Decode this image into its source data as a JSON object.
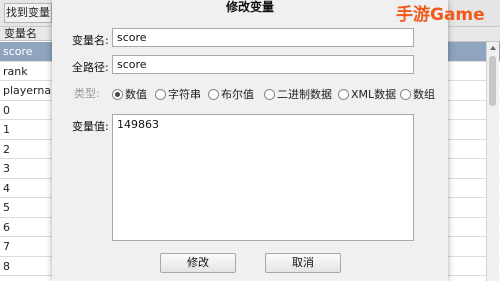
{
  "background": {
    "find_button_label": "找到变量",
    "column_header": "变量名",
    "rows": [
      {
        "name": "score",
        "selected": true
      },
      {
        "name": "rank",
        "selected": false
      },
      {
        "name": "playername",
        "selected": false
      },
      {
        "name": "0",
        "selected": false
      },
      {
        "name": "1",
        "selected": false
      },
      {
        "name": "2",
        "selected": false
      },
      {
        "name": "3",
        "selected": false
      },
      {
        "name": "4",
        "selected": false
      },
      {
        "name": "5",
        "selected": false
      },
      {
        "name": "6",
        "selected": false
      },
      {
        "name": "7",
        "selected": false
      },
      {
        "name": "8",
        "selected": false
      }
    ],
    "selection_color": "#8ea4bf"
  },
  "dialog": {
    "title": "修改变量",
    "var_name_label": "变量名:",
    "var_name_value": "score",
    "full_path_label": "全路径:",
    "full_path_value": "score",
    "type_label": "类型:",
    "types": [
      {
        "label": "数值",
        "checked": true
      },
      {
        "label": "字符串",
        "checked": false
      },
      {
        "label": "布尔值",
        "checked": false
      },
      {
        "label": "二进制数据",
        "checked": false
      },
      {
        "label": "XML数据",
        "checked": false
      },
      {
        "label": "数组",
        "checked": false
      }
    ],
    "value_label": "变量值:",
    "value": "149863",
    "modify_button": "修改",
    "cancel_button": "取消"
  },
  "watermark": {
    "text": "手游Game",
    "color": "#f05a1a"
  }
}
